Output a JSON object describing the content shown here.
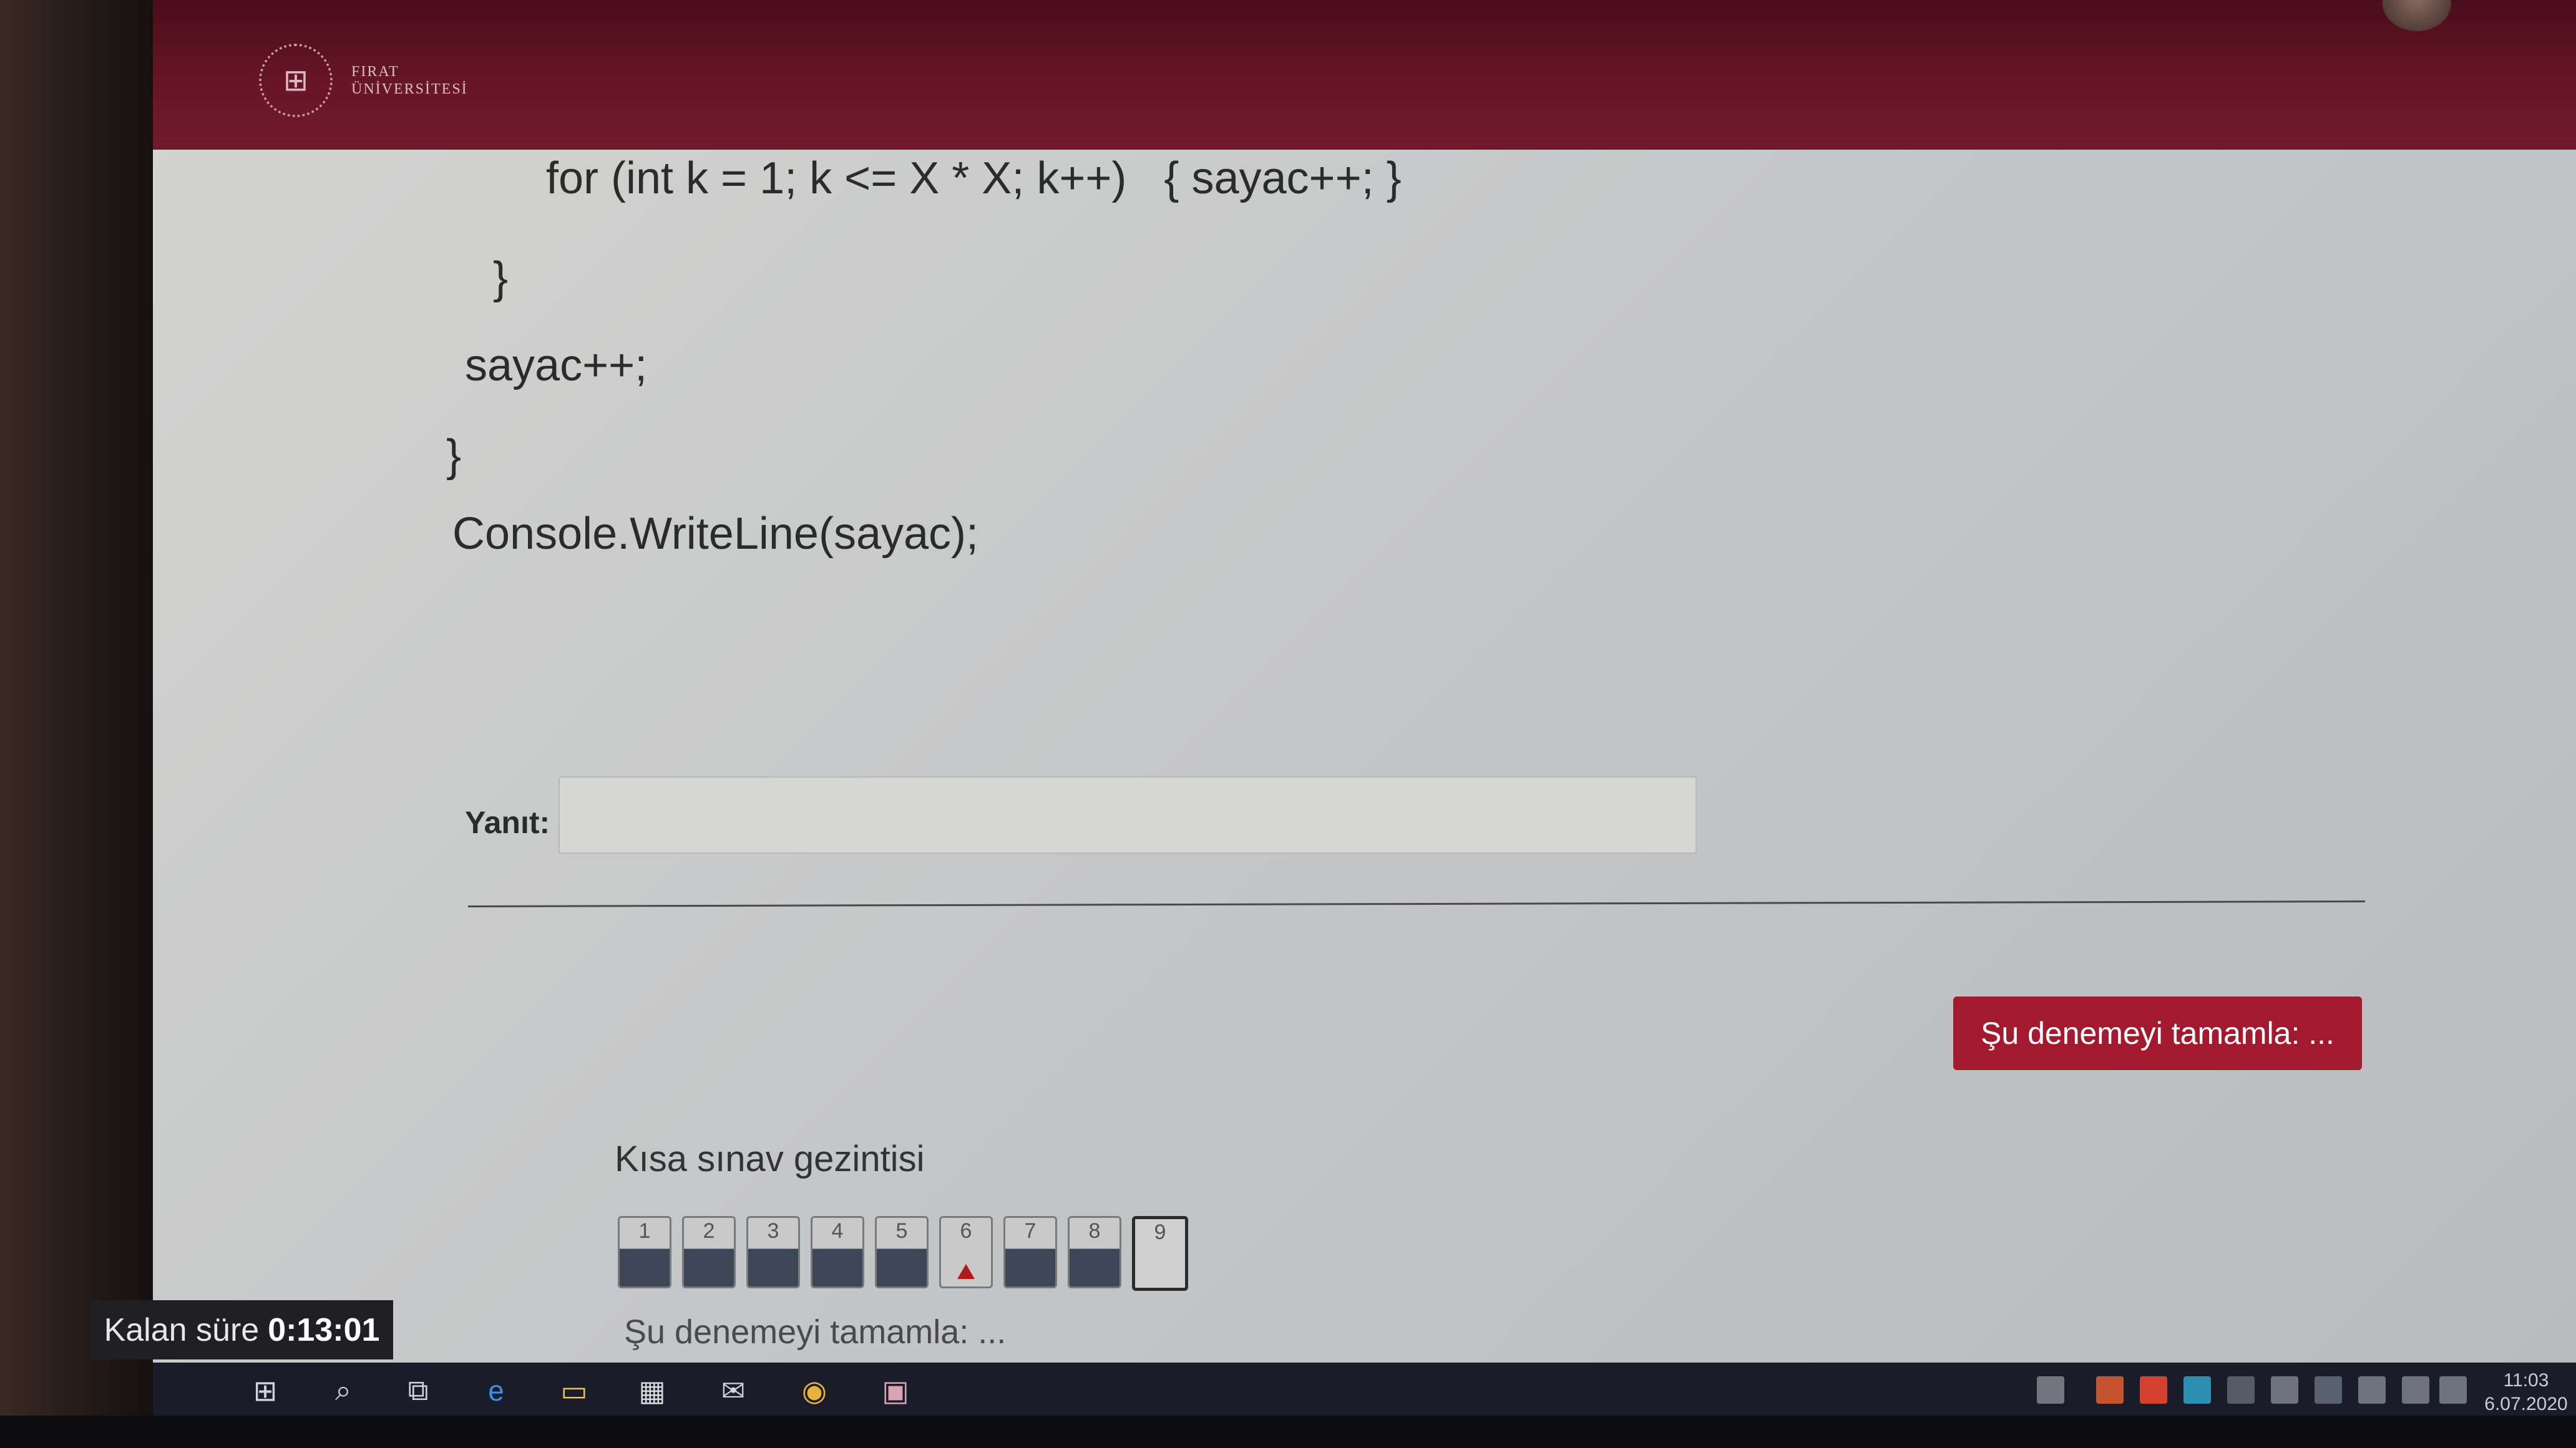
{
  "header": {
    "logo_line1": "FIRAT",
    "logo_line2": "ÜNİVERSİTESİ"
  },
  "code_lines": [
    "for (int k = 1; k <= X * X; k++)   { sayac++; }",
    "}",
    "sayac++;",
    "}",
    "Console.WriteLine(sayac);"
  ],
  "answer": {
    "label": "Yanıt:",
    "value": ""
  },
  "finish_button_label": "Şu denemeyi tamamla: ...",
  "quiz_nav": {
    "title": "Kısa sınav gezintisi",
    "questions": [
      {
        "number": "1",
        "state": "answered"
      },
      {
        "number": "2",
        "state": "answered"
      },
      {
        "number": "3",
        "state": "answered"
      },
      {
        "number": "4",
        "state": "answered"
      },
      {
        "number": "5",
        "state": "answered"
      },
      {
        "number": "6",
        "state": "flagged"
      },
      {
        "number": "7",
        "state": "answered"
      },
      {
        "number": "8",
        "state": "answered"
      },
      {
        "number": "9",
        "state": "current"
      }
    ],
    "finish_link": "Şu denemeyi tamamla: ..."
  },
  "timer": {
    "label": "Kalan süre",
    "value": "0:13:01"
  },
  "taskbar": {
    "icons": [
      "windows-start-icon",
      "search-icon",
      "task-view-icon",
      "edge-icon",
      "file-explorer-icon",
      "store-icon",
      "mail-icon",
      "chrome-icon",
      "app-icon"
    ],
    "time": "11:03",
    "date": "6.07.2020"
  },
  "colors": {
    "header": "#6a1626",
    "button": "#a3192e",
    "taskbar": "#1a1c2a"
  }
}
